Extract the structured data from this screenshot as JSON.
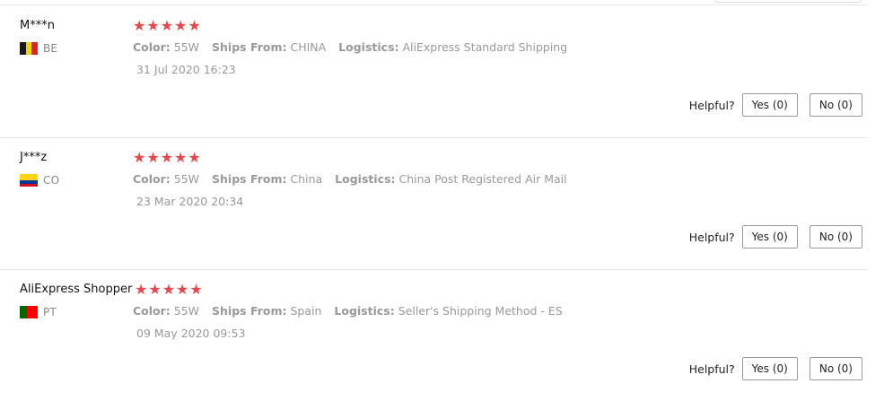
{
  "reviews": [
    {
      "user": "M***n",
      "country": "BE",
      "flag_colors": [
        "#1a1a1a",
        "#f2d400",
        "#e0202a"
      ],
      "rating": 5,
      "color_label": "Color:",
      "color_value": "55W",
      "ships_label": "Ships From:",
      "ships_value": "CHINA",
      "logistics_label": "Logistics:",
      "logistics_value": "AliExpress Standard Shipping",
      "date": "31 Jul 2020 16:23",
      "helpful_label": "Helpful?",
      "yes_label": "Yes (0)",
      "no_label": "No (0)"
    },
    {
      "user": "J***z",
      "country": "CO",
      "flag_colors": [
        "#fcd116",
        "#003893",
        "#ce1126"
      ],
      "rating": 5,
      "color_label": "Color:",
      "color_value": "55W",
      "ships_label": "Ships From:",
      "ships_value": "China",
      "logistics_label": "Logistics:",
      "logistics_value": "China Post Registered Air Mail",
      "date": "23 Mar 2020 20:34",
      "helpful_label": "Helpful?",
      "yes_label": "Yes (0)",
      "no_label": "No (0)"
    },
    {
      "user": "AliExpress Shopper",
      "country": "PT",
      "flag_colors": [
        "#006600",
        "#ff0000"
      ],
      "rating": 5,
      "color_label": "Color:",
      "color_value": "55W",
      "ships_label": "Ships From:",
      "ships_value": "Spain",
      "logistics_label": "Logistics:",
      "logistics_value": "Seller's Shipping Method - ES",
      "date": "09 May 2020 09:53",
      "helpful_label": "Helpful?",
      "yes_label": "Yes (0)",
      "no_label": "No (0)"
    }
  ],
  "star_color": "#e8474c",
  "star_glyph": "★"
}
